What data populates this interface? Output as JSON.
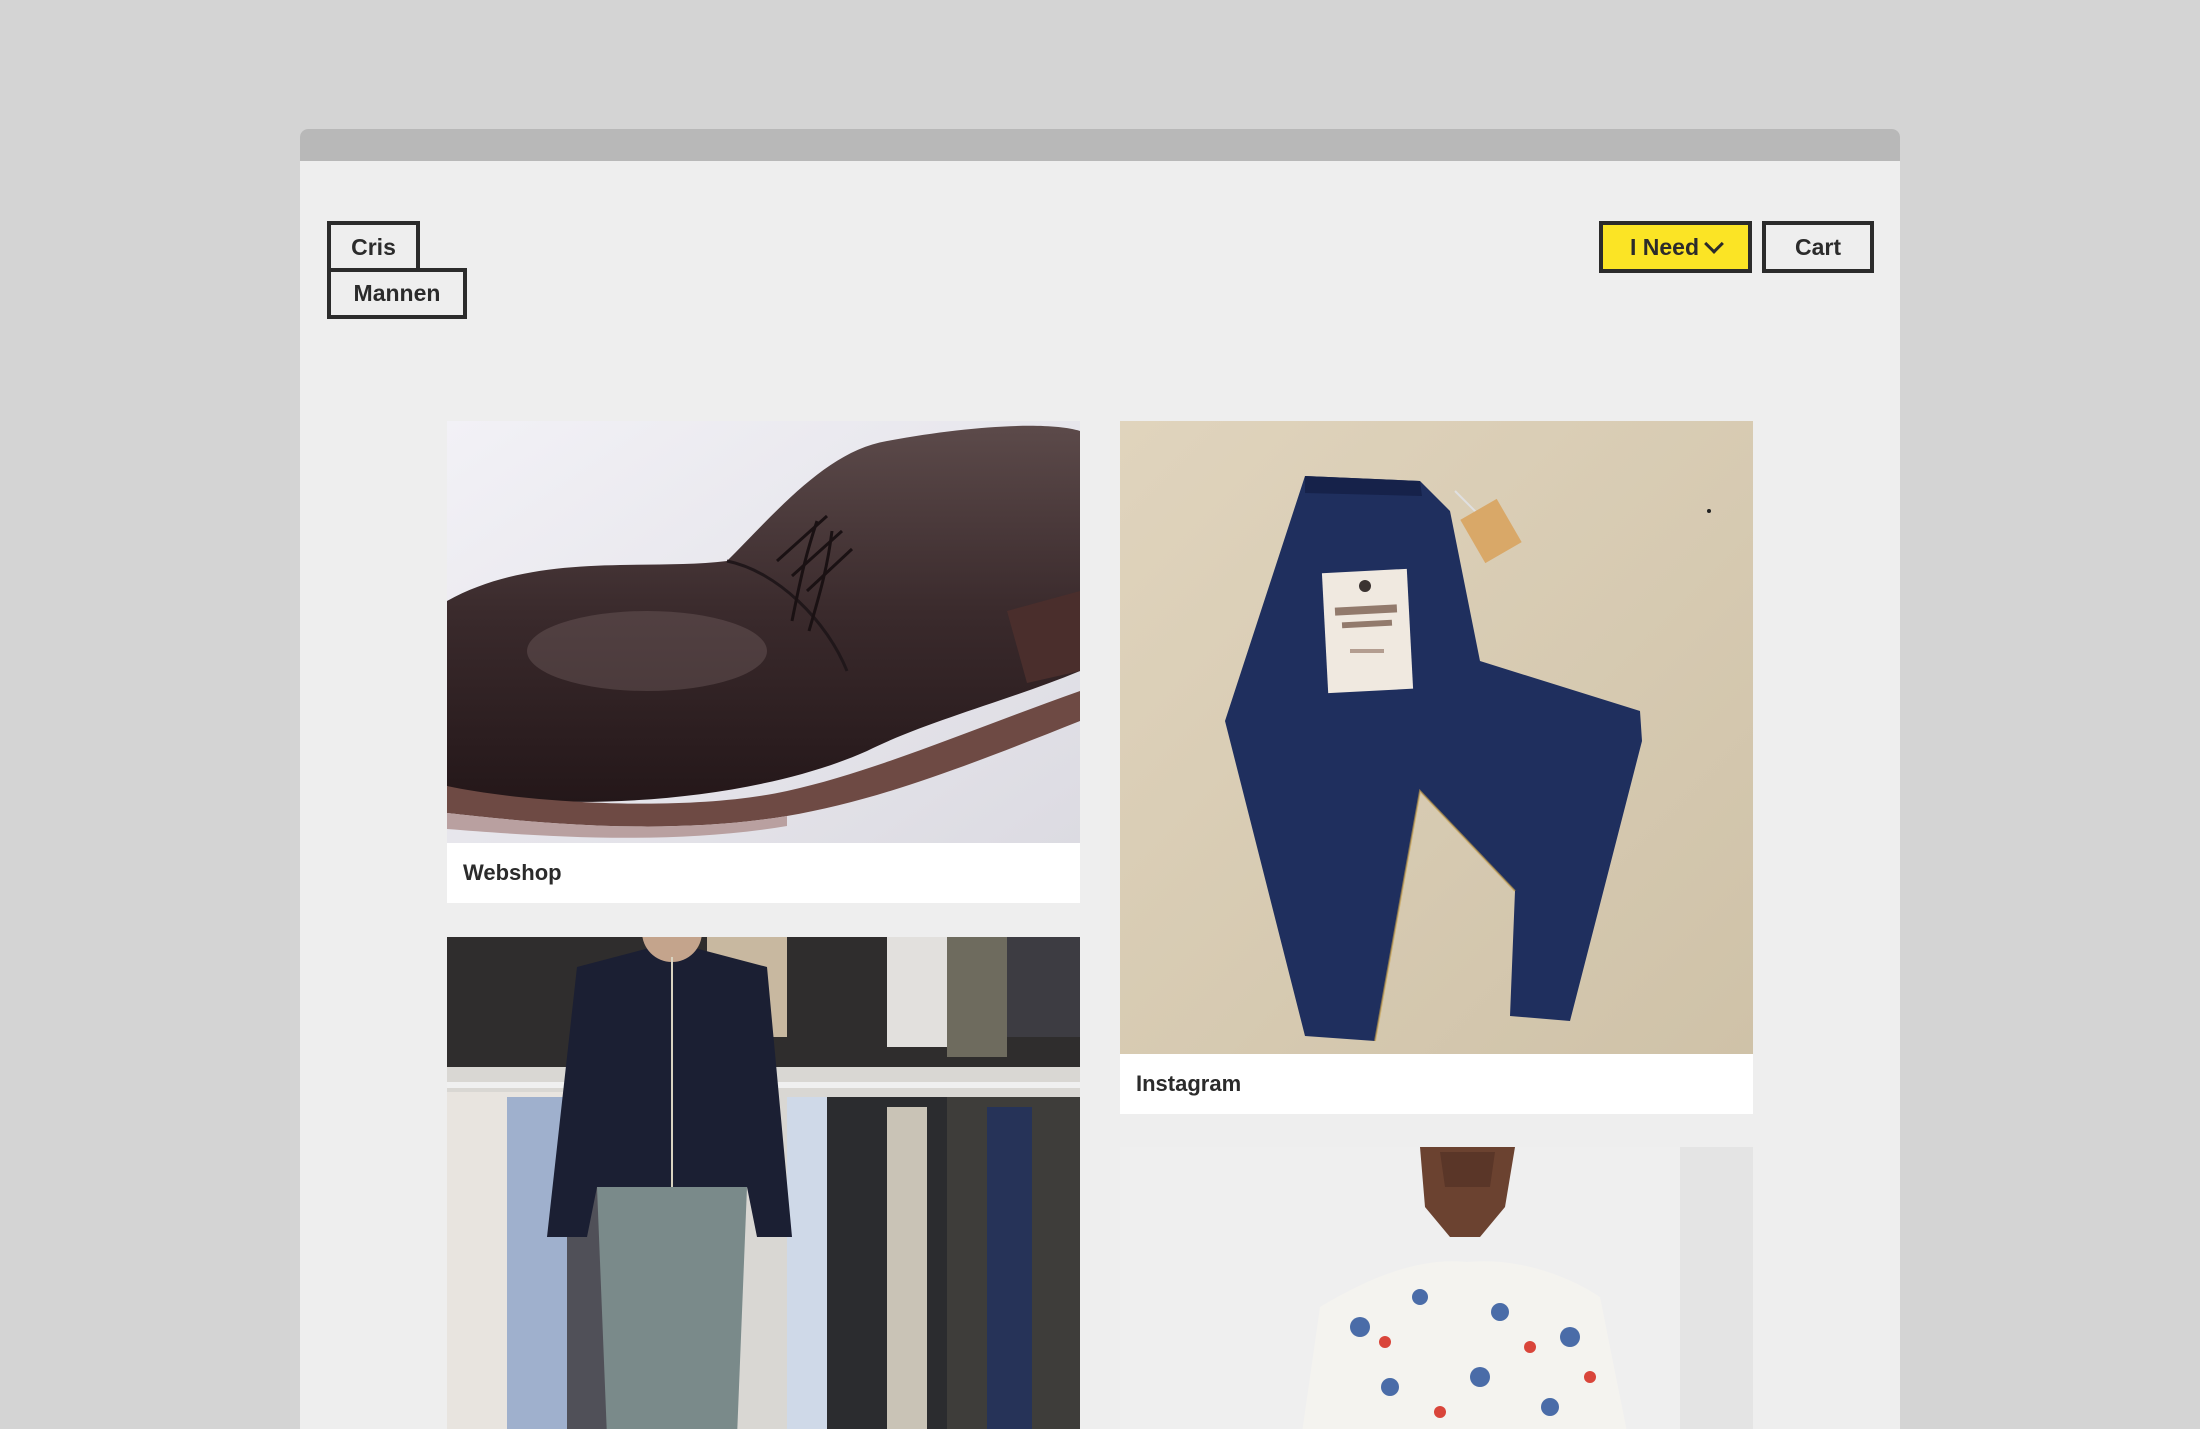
{
  "brand": {
    "line1": "Cris",
    "line2": "Mannen"
  },
  "nav": {
    "need_label": "I Need",
    "cart_label": "Cart",
    "accent": "#fbe425"
  },
  "cards": [
    {
      "label": "Webshop",
      "image": "leather-derby-shoe-photo"
    },
    {
      "label": "Instagram",
      "image": "workshop-denim-jeans-photo"
    },
    {
      "label": "",
      "image": "man-in-clothing-store-photo"
    },
    {
      "label": "",
      "image": "model-printed-sweater-photo"
    }
  ]
}
